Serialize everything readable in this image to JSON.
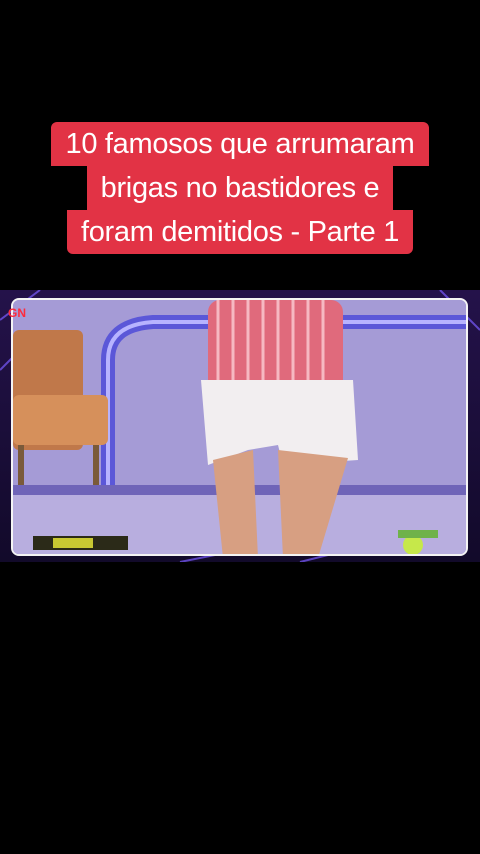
{
  "title": {
    "line1": "10 famosos que arrumaram",
    "line2": "brigas no bastidores e",
    "line3": "foram demitidos - Parte 1"
  },
  "video": {
    "logo_text": "GN",
    "accent_color": "#e23345"
  }
}
